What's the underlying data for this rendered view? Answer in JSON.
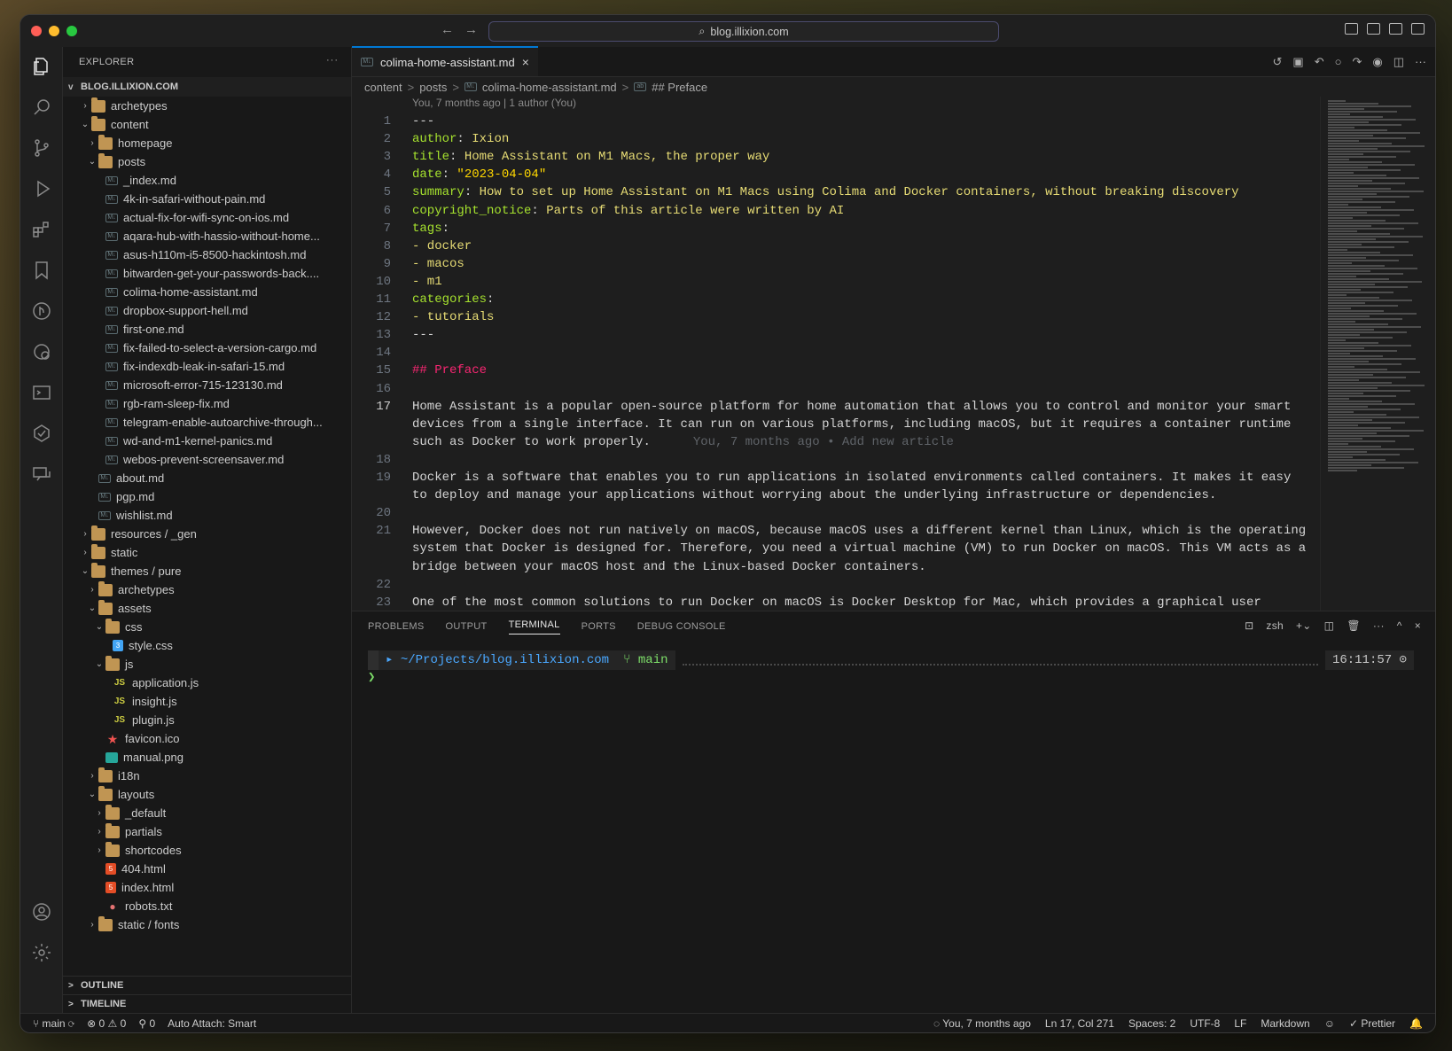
{
  "titlebar": {
    "search": "blog.illixion.com"
  },
  "sidebar": {
    "title": "EXPLORER",
    "more": "···",
    "root": "BLOG.ILLIXION.COM",
    "tree": [
      {
        "label": "archetypes",
        "depth": 1,
        "type": "folder",
        "chev": ">"
      },
      {
        "label": "content",
        "depth": 1,
        "type": "folder",
        "chev": "v"
      },
      {
        "label": "homepage",
        "depth": 2,
        "type": "folder",
        "chev": ">"
      },
      {
        "label": "posts",
        "depth": 2,
        "type": "folder",
        "chev": "v"
      },
      {
        "label": "_index.md",
        "depth": 3,
        "type": "md"
      },
      {
        "label": "4k-in-safari-without-pain.md",
        "depth": 3,
        "type": "md"
      },
      {
        "label": "actual-fix-for-wifi-sync-on-ios.md",
        "depth": 3,
        "type": "md"
      },
      {
        "label": "aqara-hub-with-hassio-without-home...",
        "depth": 3,
        "type": "md"
      },
      {
        "label": "asus-h110m-i5-8500-hackintosh.md",
        "depth": 3,
        "type": "md"
      },
      {
        "label": "bitwarden-get-your-passwords-back....",
        "depth": 3,
        "type": "md"
      },
      {
        "label": "colima-home-assistant.md",
        "depth": 3,
        "type": "md"
      },
      {
        "label": "dropbox-support-hell.md",
        "depth": 3,
        "type": "md"
      },
      {
        "label": "first-one.md",
        "depth": 3,
        "type": "md"
      },
      {
        "label": "fix-failed-to-select-a-version-cargo.md",
        "depth": 3,
        "type": "md"
      },
      {
        "label": "fix-indexdb-leak-in-safari-15.md",
        "depth": 3,
        "type": "md"
      },
      {
        "label": "microsoft-error-715-123130.md",
        "depth": 3,
        "type": "md"
      },
      {
        "label": "rgb-ram-sleep-fix.md",
        "depth": 3,
        "type": "md"
      },
      {
        "label": "telegram-enable-autoarchive-through...",
        "depth": 3,
        "type": "md"
      },
      {
        "label": "wd-and-m1-kernel-panics.md",
        "depth": 3,
        "type": "md"
      },
      {
        "label": "webos-prevent-screensaver.md",
        "depth": 3,
        "type": "md"
      },
      {
        "label": "about.md",
        "depth": 2,
        "type": "md"
      },
      {
        "label": "pgp.md",
        "depth": 2,
        "type": "md"
      },
      {
        "label": "wishlist.md",
        "depth": 2,
        "type": "md"
      },
      {
        "label": "resources / _gen",
        "depth": 1,
        "type": "folder",
        "chev": ">"
      },
      {
        "label": "static",
        "depth": 1,
        "type": "folder",
        "chev": ">"
      },
      {
        "label": "themes / pure",
        "depth": 1,
        "type": "folder",
        "chev": "v"
      },
      {
        "label": "archetypes",
        "depth": 2,
        "type": "folder",
        "chev": ">"
      },
      {
        "label": "assets",
        "depth": 2,
        "type": "folder",
        "chev": "v"
      },
      {
        "label": "css",
        "depth": 3,
        "type": "folder",
        "chev": "v"
      },
      {
        "label": "style.css",
        "depth": 4,
        "type": "css"
      },
      {
        "label": "js",
        "depth": 3,
        "type": "folder",
        "chev": "v"
      },
      {
        "label": "application.js",
        "depth": 4,
        "type": "js"
      },
      {
        "label": "insight.js",
        "depth": 4,
        "type": "js"
      },
      {
        "label": "plugin.js",
        "depth": 4,
        "type": "js"
      },
      {
        "label": "favicon.ico",
        "depth": 3,
        "type": "fav"
      },
      {
        "label": "manual.png",
        "depth": 3,
        "type": "img"
      },
      {
        "label": "i18n",
        "depth": 2,
        "type": "folder",
        "chev": ">"
      },
      {
        "label": "layouts",
        "depth": 2,
        "type": "folder",
        "chev": "v"
      },
      {
        "label": "_default",
        "depth": 3,
        "type": "folder",
        "chev": ">"
      },
      {
        "label": "partials",
        "depth": 3,
        "type": "folder",
        "chev": ">"
      },
      {
        "label": "shortcodes",
        "depth": 3,
        "type": "folder",
        "chev": ">"
      },
      {
        "label": "404.html",
        "depth": 3,
        "type": "html"
      },
      {
        "label": "index.html",
        "depth": 3,
        "type": "html"
      },
      {
        "label": "robots.txt",
        "depth": 3,
        "type": "txt"
      },
      {
        "label": "static / fonts",
        "depth": 2,
        "type": "folder",
        "chev": ">"
      }
    ],
    "outline": "OUTLINE",
    "timeline": "TIMELINE"
  },
  "editor": {
    "tab_label": "colima-home-assistant.md",
    "breadcrumbs": [
      "content",
      "posts",
      "colima-home-assistant.md",
      "## Preface"
    ],
    "blame_header": "You, 7 months ago | 1 author (You)",
    "inline_blame": "You, 7 months ago • Add new article",
    "lines": [
      {
        "n": "1",
        "parts": [
          [
            "---",
            "plain"
          ]
        ]
      },
      {
        "n": "2",
        "parts": [
          [
            "author",
            "k"
          ],
          [
            ": ",
            "plain"
          ],
          [
            "Ixion",
            "v"
          ]
        ]
      },
      {
        "n": "3",
        "parts": [
          [
            "title",
            "k"
          ],
          [
            ": ",
            "plain"
          ],
          [
            "Home Assistant on M1 Macs, the proper way",
            "v"
          ]
        ]
      },
      {
        "n": "4",
        "parts": [
          [
            "date",
            "k"
          ],
          [
            ": ",
            "plain"
          ],
          [
            "\"2023-04-04\"",
            "y"
          ]
        ]
      },
      {
        "n": "5",
        "parts": [
          [
            "summary",
            "k"
          ],
          [
            ": ",
            "plain"
          ],
          [
            "How to set up Home Assistant on M1 Macs using Colima and Docker containers, without breaking discovery",
            "v"
          ]
        ]
      },
      {
        "n": "6",
        "parts": [
          [
            "copyright_notice",
            "k"
          ],
          [
            ": ",
            "plain"
          ],
          [
            "Parts of this article were written by AI",
            "v"
          ]
        ]
      },
      {
        "n": "7",
        "parts": [
          [
            "tags",
            "k"
          ],
          [
            ":",
            "plain"
          ]
        ]
      },
      {
        "n": "8",
        "parts": [
          [
            "- docker",
            "v"
          ]
        ]
      },
      {
        "n": "9",
        "parts": [
          [
            "- macos",
            "v"
          ]
        ]
      },
      {
        "n": "10",
        "parts": [
          [
            "- m1",
            "v"
          ]
        ]
      },
      {
        "n": "11",
        "parts": [
          [
            "categories",
            "k"
          ],
          [
            ":",
            "plain"
          ]
        ]
      },
      {
        "n": "12",
        "parts": [
          [
            "- tutorials",
            "v"
          ]
        ]
      },
      {
        "n": "13",
        "parts": [
          [
            "---",
            "plain"
          ]
        ]
      },
      {
        "n": "14",
        "parts": []
      },
      {
        "n": "15",
        "parts": [
          [
            "## Preface",
            "md-h"
          ]
        ]
      },
      {
        "n": "16",
        "parts": []
      },
      {
        "n": "17",
        "parts": [
          [
            "Home Assistant is a popular open-source platform for home automation that allows you to control and monitor your smart",
            "plain"
          ]
        ]
      },
      {
        "n": "",
        "parts": [
          [
            "devices from a single interface. It can run on various platforms, including macOS, but it requires a container runtime",
            "plain"
          ]
        ]
      },
      {
        "n": "",
        "parts": [
          [
            "such as Docker to work properly.",
            "plain"
          ]
        ],
        "blame": true
      },
      {
        "n": "18",
        "parts": []
      },
      {
        "n": "19",
        "parts": [
          [
            "Docker is a software that enables you to run applications in isolated environments called containers. It makes it easy",
            "plain"
          ]
        ]
      },
      {
        "n": "",
        "parts": [
          [
            "to deploy and manage your applications without worrying about the underlying infrastructure or dependencies.",
            "plain"
          ]
        ]
      },
      {
        "n": "20",
        "parts": []
      },
      {
        "n": "21",
        "parts": [
          [
            "However, Docker does not run natively on macOS, because macOS uses a different kernel than Linux, which is the operating",
            "plain"
          ]
        ]
      },
      {
        "n": "",
        "parts": [
          [
            "system that Docker is designed for. Therefore, you need a virtual machine (VM) to run Docker on macOS. This VM acts as a",
            "plain"
          ]
        ]
      },
      {
        "n": "",
        "parts": [
          [
            "bridge between your macOS host and the Linux-based Docker containers.",
            "plain"
          ]
        ]
      },
      {
        "n": "22",
        "parts": []
      },
      {
        "n": "23",
        "parts": [
          [
            "One of the most common solutions to run Docker on macOS is Docker Desktop for Mac, which provides a graphical user",
            "plain"
          ]
        ]
      }
    ]
  },
  "panel": {
    "tabs": [
      "PROBLEMS",
      "OUTPUT",
      "TERMINAL",
      "PORTS",
      "DEBUG CONSOLE"
    ],
    "active_tab": "TERMINAL",
    "shell": "zsh",
    "terminal": {
      "path": "~/Projects/blog.illixion.com",
      "branch": "main",
      "time": "16:11:57",
      "prompt": "❯"
    }
  },
  "statusbar": {
    "branch": "main",
    "errors": "0",
    "warnings": "0",
    "ports": "0",
    "auto_attach": "Auto Attach: Smart",
    "blame": "You, 7 months ago",
    "position": "Ln 17, Col 271",
    "spaces": "Spaces: 2",
    "encoding": "UTF-8",
    "eol": "LF",
    "language": "Markdown",
    "formatter": "Prettier"
  }
}
